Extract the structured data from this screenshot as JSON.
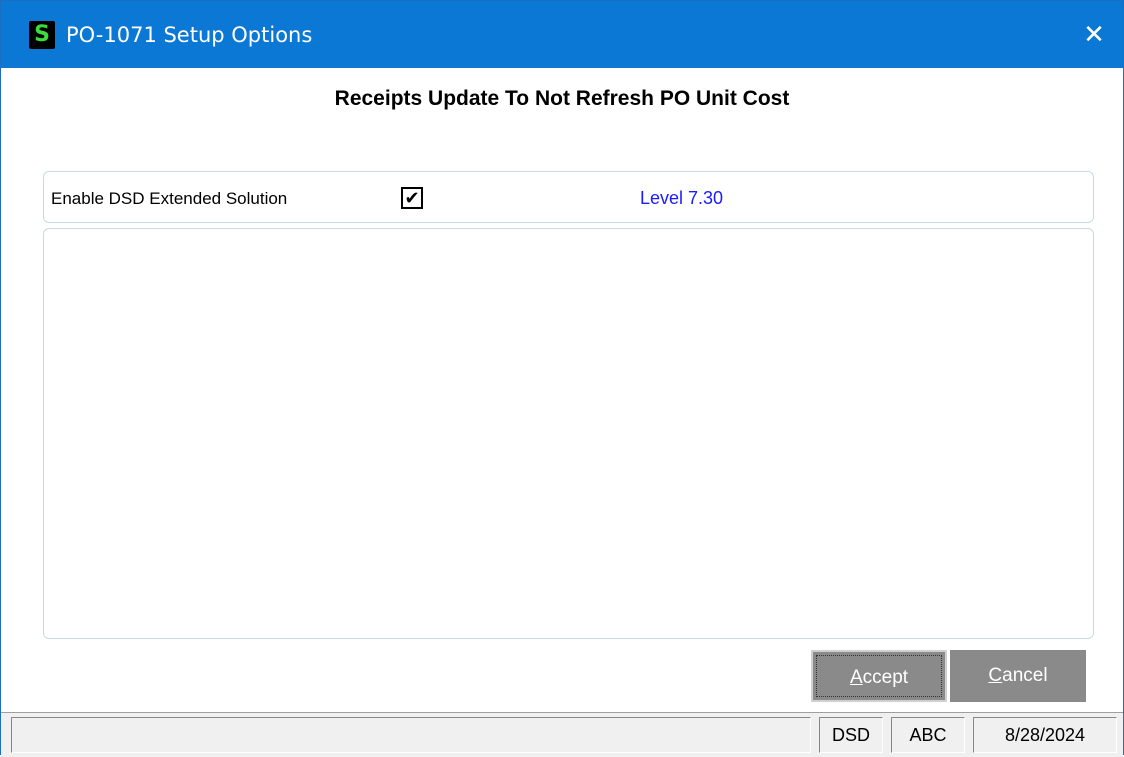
{
  "window": {
    "title": "PO-1071 Setup Options",
    "icon": "sage-s-icon",
    "close_glyph": "✕"
  },
  "heading": "Receipts Update To Not Refresh PO Unit Cost",
  "options": {
    "enable_label": "Enable DSD Extended Solution",
    "enable_checked": true,
    "check_glyph": "✔",
    "level": "Level  7.30",
    "level_color": "#1a1aff"
  },
  "buttons": {
    "accept_mnemonic": "A",
    "accept_rest": "ccept",
    "cancel_mnemonic": "C",
    "cancel_rest": "ancel"
  },
  "statusbar": {
    "main": "",
    "company_code": "DSD",
    "user": "ABC",
    "date": "8/28/2024"
  }
}
